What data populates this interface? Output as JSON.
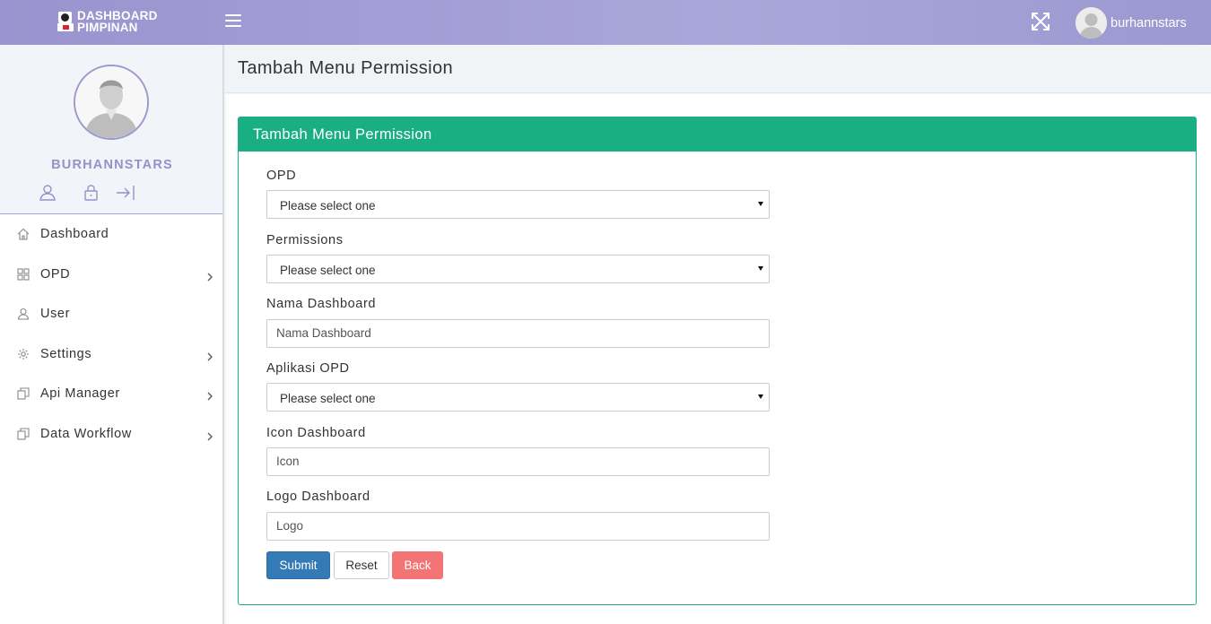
{
  "header": {
    "logo_line1": "DASHBOARD",
    "logo_line2": "PIMPINAN",
    "username": "burhannstars",
    "bar_color": "#9b97d0"
  },
  "sidebar": {
    "profile_name": "BURHANNSTARS",
    "profile_actions": [
      "user-icon",
      "lock-icon",
      "logout-icon"
    ],
    "items": [
      {
        "label": "Dashboard",
        "icon": "home-icon",
        "has_children": false
      },
      {
        "label": "OPD",
        "icon": "grid-icon",
        "has_children": true
      },
      {
        "label": "User",
        "icon": "user-icon",
        "has_children": false
      },
      {
        "label": "Settings",
        "icon": "gear-icon",
        "has_children": true
      },
      {
        "label": "Api Manager",
        "icon": "copy-icon",
        "has_children": true
      },
      {
        "label": "Data Workflow",
        "icon": "copy-icon",
        "has_children": true
      }
    ]
  },
  "page": {
    "title": "Tambah Menu Permission"
  },
  "form": {
    "panel_title": "Tambah Menu Permission",
    "accent_color": "#19ae84",
    "fields": [
      {
        "label": "OPD",
        "type": "select",
        "value": "Please select one"
      },
      {
        "label": "Permissions",
        "type": "select",
        "value": "Please select one"
      },
      {
        "label": "Nama Dashboard",
        "type": "text",
        "placeholder": "Nama Dashboard"
      },
      {
        "label": "Aplikasi OPD",
        "type": "select",
        "value": "Please select one"
      },
      {
        "label": "Icon Dashboard",
        "type": "text",
        "placeholder": "Icon"
      },
      {
        "label": "Logo Dashboard",
        "type": "text",
        "placeholder": "Logo"
      }
    ],
    "buttons": {
      "submit": "Submit",
      "reset": "Reset",
      "back": "Back"
    }
  }
}
